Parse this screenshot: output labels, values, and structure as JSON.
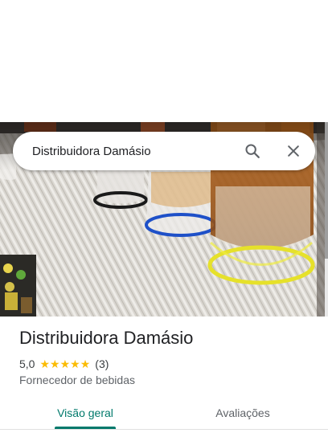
{
  "search": {
    "value": "Distribuidora Damásio",
    "search_icon": "search-icon",
    "close_icon": "close-icon"
  },
  "place": {
    "name": "Distribuidora Damásio",
    "rating": "5,0",
    "stars_filled": 5,
    "review_count": "(3)",
    "category": "Fornecedor de bebidas"
  },
  "tabs": [
    {
      "label": "Visão geral",
      "selected": true
    },
    {
      "label": "Avaliações",
      "selected": false
    }
  ],
  "colors": {
    "accent": "#00796b",
    "star": "#fbbc04"
  }
}
